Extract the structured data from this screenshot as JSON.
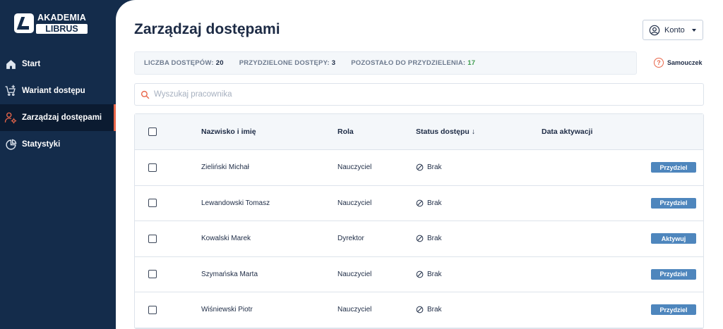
{
  "logo": {
    "line1": "AKADEMIA",
    "line2": "LIBRUS"
  },
  "nav": [
    {
      "label": "Start",
      "icon": "home-icon"
    },
    {
      "label": "Wariant dostępu",
      "icon": "cart-icon"
    },
    {
      "label": "Zarządzaj dostępami",
      "icon": "user-gear-icon",
      "active": true
    },
    {
      "label": "Statystyki",
      "icon": "pie-chart-icon"
    }
  ],
  "header": {
    "title": "Zarządzaj dostępami",
    "account_label": "Konto"
  },
  "stats": [
    {
      "label": "LICZBA DOSTĘPÓW:",
      "value": "20"
    },
    {
      "label": "PRZYDZIELONE DOSTĘPY:",
      "value": "3"
    },
    {
      "label": "POZOSTAŁO DO PRZYDZIELENIA:",
      "value": "17"
    }
  ],
  "tutorial": {
    "label": "Samouczek"
  },
  "search": {
    "placeholder": "Wyszukaj pracownika",
    "value": ""
  },
  "table": {
    "columns": {
      "name": "Nazwisko i imię",
      "role": "Rola",
      "status": "Status dostępu ↓",
      "date": "Data aktywacji"
    },
    "rows": [
      {
        "name": "Zieliński Michał",
        "role": "Nauczyciel",
        "status": "Brak",
        "date": "",
        "action": "Przydziel"
      },
      {
        "name": "Lewandowski Tomasz",
        "role": "Nauczyciel",
        "status": "Brak",
        "date": "",
        "action": "Przydziel"
      },
      {
        "name": "Kowalski Marek",
        "role": "Dyrektor",
        "status": "Brak",
        "date": "",
        "action": "Aktywuj"
      },
      {
        "name": "Szymańska Marta",
        "role": "Nauczyciel",
        "status": "Brak",
        "date": "",
        "action": "Przydziel"
      },
      {
        "name": "Wiśniewski Piotr",
        "role": "Nauczyciel",
        "status": "Brak",
        "date": "",
        "action": "Przydziel"
      }
    ]
  },
  "colors": {
    "sidebar": "#142c4b",
    "accent": "#e8664a",
    "button": "#4e86bd",
    "green": "#3e9b4d"
  }
}
